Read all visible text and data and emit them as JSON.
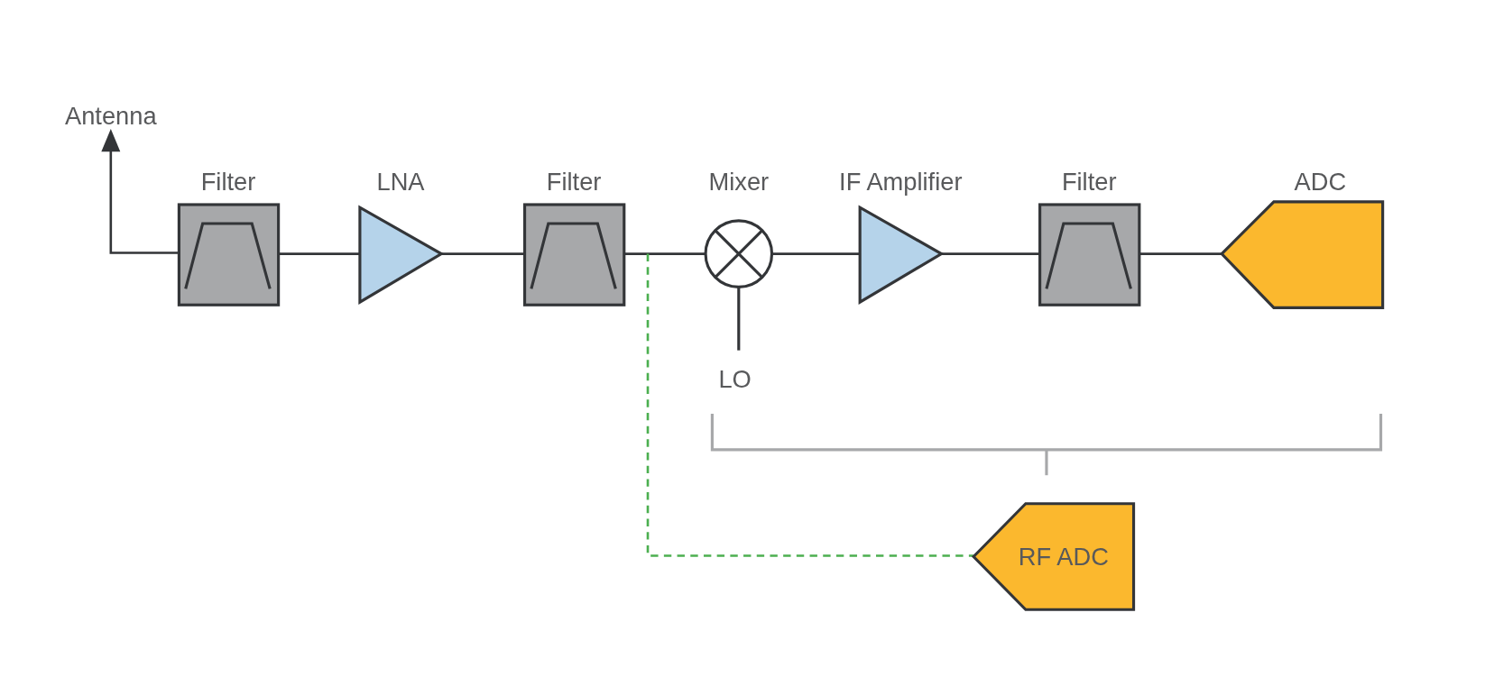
{
  "antenna": {
    "label": "Antenna"
  },
  "chain": [
    {
      "kind": "filter",
      "label": "Filter"
    },
    {
      "kind": "amplifier",
      "label": "LNA"
    },
    {
      "kind": "filter",
      "label": "Filter"
    },
    {
      "kind": "mixer",
      "label": "Mixer",
      "port_label": "LO"
    },
    {
      "kind": "amplifier",
      "label": "IF Amplifier"
    },
    {
      "kind": "filter",
      "label": "Filter"
    },
    {
      "kind": "adc",
      "label": "ADC"
    }
  ],
  "direct_path": {
    "label": "RF ADC"
  }
}
